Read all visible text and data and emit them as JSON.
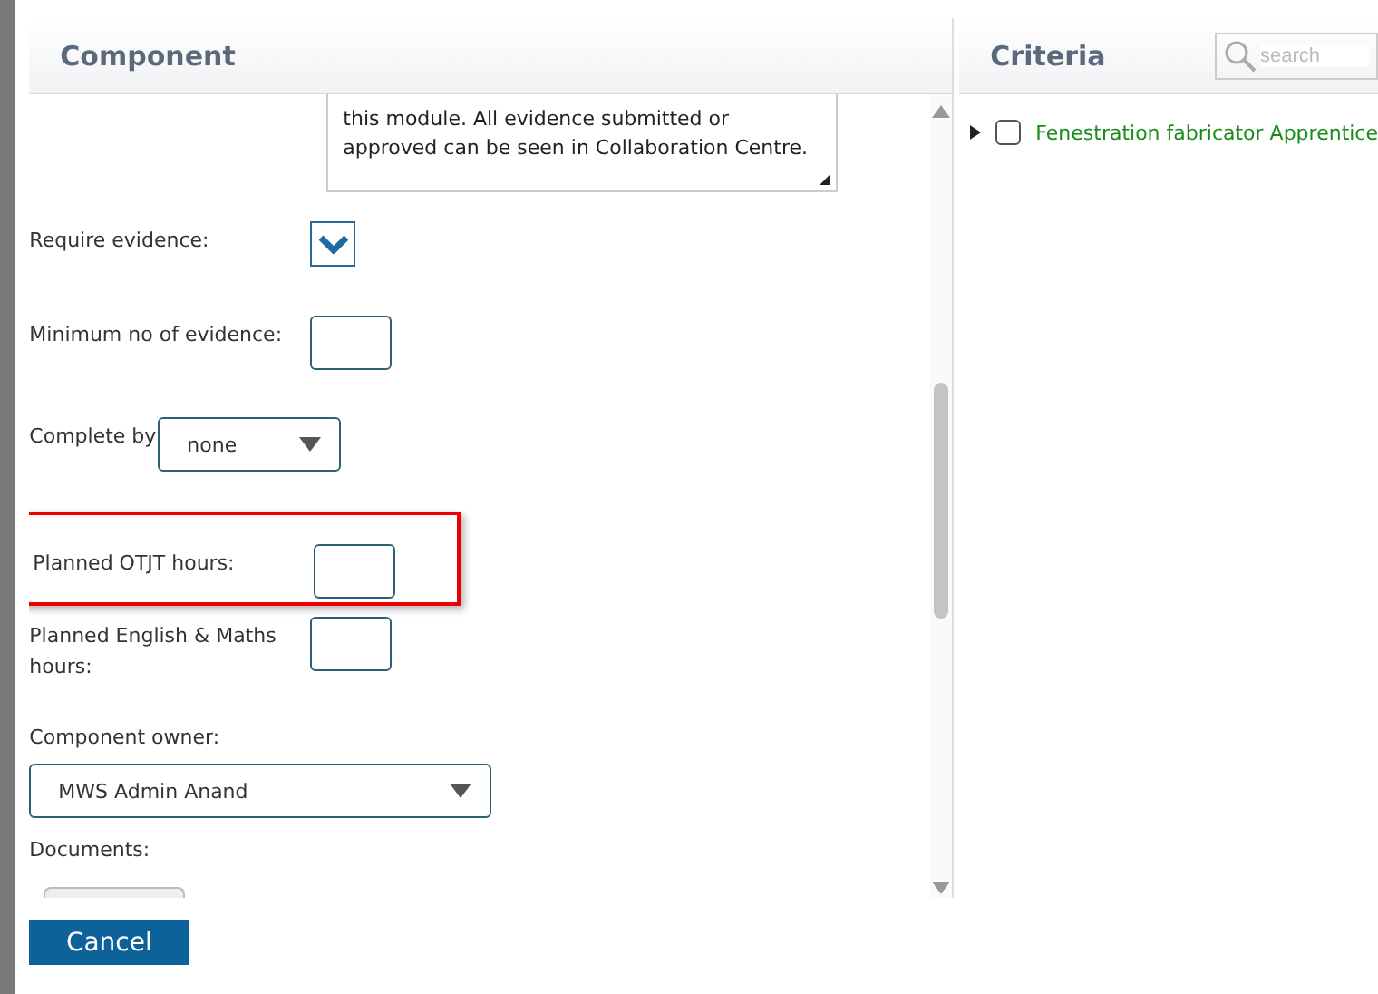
{
  "left_panel": {
    "title": "Component",
    "description": "this module. All evidence submitted or approved can be seen in Collaboration Centre.",
    "fields": [
      {
        "kind": "checkbox",
        "label": "Require evidence:",
        "checked": true,
        "highlighted": false
      },
      {
        "kind": "number",
        "label": "Minimum no of evidence:",
        "highlighted": false
      },
      {
        "kind": "select",
        "label": "Complete by",
        "value": "none",
        "highlighted": false
      },
      {
        "kind": "number",
        "label": "Planned OTJT hours:",
        "highlighted": true
      },
      {
        "kind": "number",
        "label": "Planned English & Maths hours:",
        "highlighted": false
      },
      {
        "kind": "wide-select",
        "label": "Component owner:",
        "value": "MWS Admin Anand",
        "highlighted": false
      },
      {
        "kind": "documents",
        "label": "Documents:",
        "highlighted": false
      }
    ]
  },
  "right_panel": {
    "title": "Criteria",
    "search": {
      "placeholder": "search"
    },
    "items": [
      {
        "label": "Fenestration fabricator Apprentice",
        "expanded": false,
        "checked": false
      }
    ]
  },
  "buttons": [
    {
      "label": "Cancel"
    }
  ]
}
